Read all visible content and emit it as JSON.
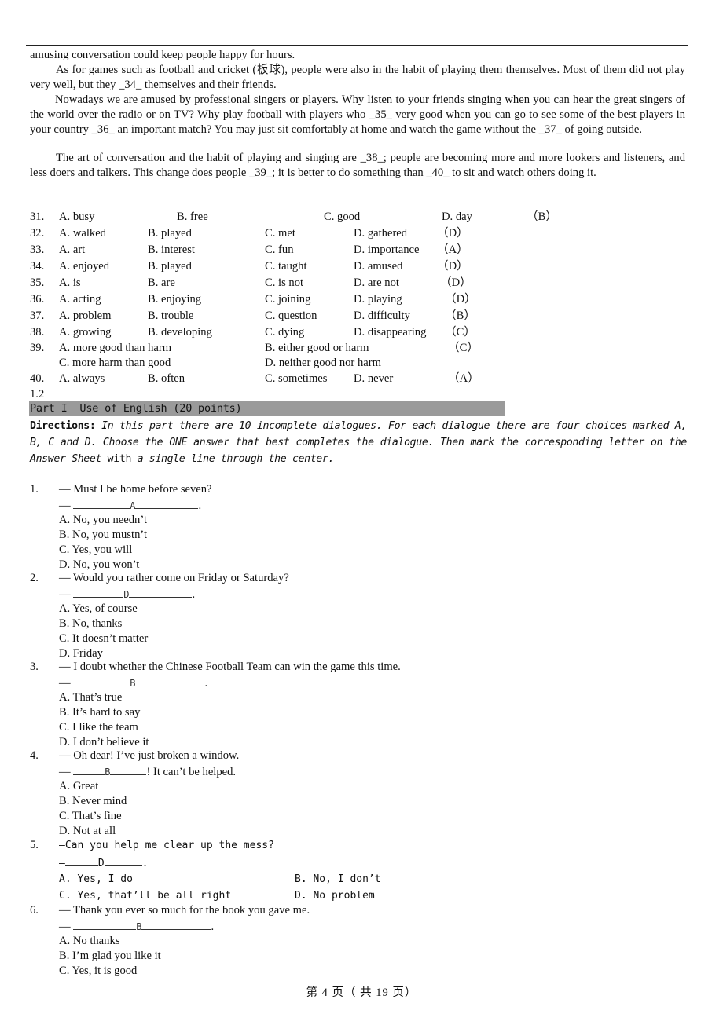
{
  "passage": {
    "p0": "amusing conversation could keep people happy for hours.",
    "p1": "As for games such as football and cricket (板球), people were also in the habit of playing them themselves. Most of them did not play very well, but they _34_ themselves and their friends.",
    "p2": "Nowadays we are amused by professional singers or players. Why listen to your friends singing when you can hear the great singers of the world over the radio or on TV? Why play football with players who _35_ very good when you can go to see some of the best players in your country _36_ an important match? You may just sit comfortably at home and watch the game without the _37_ of going outside.",
    "p3": "The art of conversation and the habit of playing and singing are _38_; people are becoming more and more lookers and listeners, and less doers and talkers. This change does people _39_; it is better to do something than _40_ to sit and watch others doing it."
  },
  "cloze": [
    {
      "num": "31.",
      "a": "A. busy",
      "b": "B. free",
      "c": "C. good",
      "d": "D. day",
      "ans": "（B）"
    },
    {
      "num": "32.",
      "a": "A. walked",
      "b": "B. played",
      "c": "C. met",
      "d": "D. gathered",
      "ans": "（D）"
    },
    {
      "num": "33.",
      "a": "A. art",
      "b": "B. interest",
      "c": "C. fun",
      "d": "D. importance",
      "ans": "（A）"
    },
    {
      "num": "34.",
      "a": "A. enjoyed",
      "b": "B. played",
      "c": "C. taught",
      "d": "D. amused",
      "ans": "（D）"
    },
    {
      "num": "35.",
      "a": "A. is",
      "b": "B. are",
      "c": "C. is not",
      "d": "D. are not",
      "ans": "（D）"
    },
    {
      "num": "36.",
      "a": "A. acting",
      "b": "B. enjoying",
      "c": "C. joining",
      "d": "D. playing",
      "ans": "（D）"
    },
    {
      "num": "37.",
      "a": "A. problem",
      "b": "B. trouble",
      "c": "C. question",
      "d": "D. difficulty",
      "ans": "（B）"
    },
    {
      "num": "38.",
      "a": "A. growing",
      "b": "B. developing",
      "c": "C. dying",
      "d": "D. disappearing",
      "ans": "（C）"
    },
    {
      "num": "39.",
      "a": "A. more good than harm",
      "b": "B. either good or harm",
      "c": "C. more harm than good",
      "d": "D. neither good nor harm",
      "ans": "（C）"
    },
    {
      "num": "40.",
      "a": "A. always",
      "b": "B. often",
      "c": "C. sometimes",
      "d": "D. never",
      "ans": "（A）"
    }
  ],
  "section_number": "1.2",
  "section": {
    "title": "Part I  Use of English (20 points)",
    "directions_label": "Directions:",
    "directions_text_1": " In this part there are 10 incomplete dialogues. For each dialogue there are four choices marked A, B, C and D. Choose the ONE answer that best completes the dialogue. Then mark the corresponding letter on the Answer Sheet ",
    "directions_with": "with",
    "directions_text_2": " a single line through the center."
  },
  "dialogues": [
    {
      "num": "1.",
      "prompt": "— Must I be home before seven?",
      "dash": "— ",
      "answer": "A",
      "after": ".",
      "options": [
        "A. No, you needn’t",
        "B. No, you mustn’t",
        "C. Yes, you will",
        "D. No, you won’t"
      ]
    },
    {
      "num": "2.",
      "prompt": "— Would you rather come on Friday or Saturday?",
      "dash": "— ",
      "answer": "D",
      "after": ".",
      "options": [
        "A. Yes, of course",
        "B. No, thanks",
        "C. It doesn’t matter",
        "D. Friday"
      ]
    },
    {
      "num": "3.",
      "prompt": "— I doubt whether the Chinese Football Team can win the game this time.",
      "dash": "— ",
      "answer": "B",
      "after": ".",
      "options": [
        "A. That’s true",
        "B. It’s hard to say",
        "C. I like the team",
        "D. I don’t believe it"
      ]
    },
    {
      "num": "4.",
      "prompt": "— Oh dear! I’ve just broken a window.",
      "dash": "— ",
      "answer": "B",
      "after": "! It can’t be helped.",
      "options": [
        "A. Great",
        "B. Never mind",
        "C. That’s fine",
        "D. Not at all"
      ]
    },
    {
      "num": "5.",
      "prompt": "—Can you help me clear up the mess?",
      "dash": "—",
      "answer": "D",
      "after": ".",
      "options": [
        "A. Yes, I do",
        "B. No, I don’t",
        "C. Yes, that’ll be all right",
        "D. No problem"
      ]
    },
    {
      "num": "6.",
      "prompt": "— Thank you ever so much for the book you gave me.",
      "dash": "— ",
      "answer": "B",
      "after": ".",
      "options": [
        "A. No thanks",
        "B. I’m glad you like it",
        "C. Yes, it is good"
      ]
    }
  ],
  "footer": "第 4 页（ 共 19 页）"
}
